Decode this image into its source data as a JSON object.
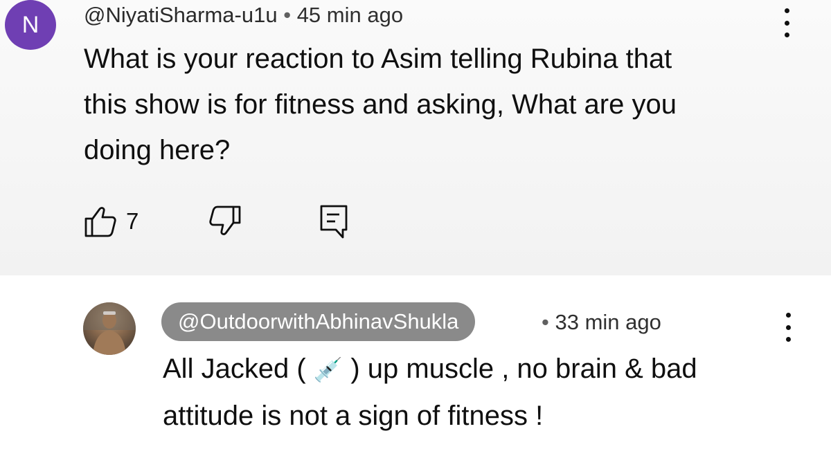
{
  "comment1": {
    "avatar_letter": "N",
    "author": "@NiyatiSharma-u1u",
    "separator": "•",
    "time": "45 min ago",
    "text_line1": "What is your reaction to Asim telling Rubina that",
    "text_line2": "this show is for fitness and asking, What are you",
    "text_line3": "doing here?",
    "like_count": "7",
    "avatar_color": "#6f3fb3",
    "icons": [
      "thumbs-up-icon",
      "thumbs-down-icon",
      "reply-icon",
      "more-vert-icon"
    ]
  },
  "comment2": {
    "author": "@OutdoorwithAbhinavShukla",
    "separator": "•",
    "time": "33 min ago",
    "text_part1": "All Jacked (",
    "emoji": "💉",
    "text_part2": ") up muscle , no brain & bad",
    "text_line2": "attitude is not a sign of fitness !",
    "chip_color": "#8a8a8a",
    "icons": [
      "profile-photo-avatar",
      "more-vert-icon"
    ]
  }
}
